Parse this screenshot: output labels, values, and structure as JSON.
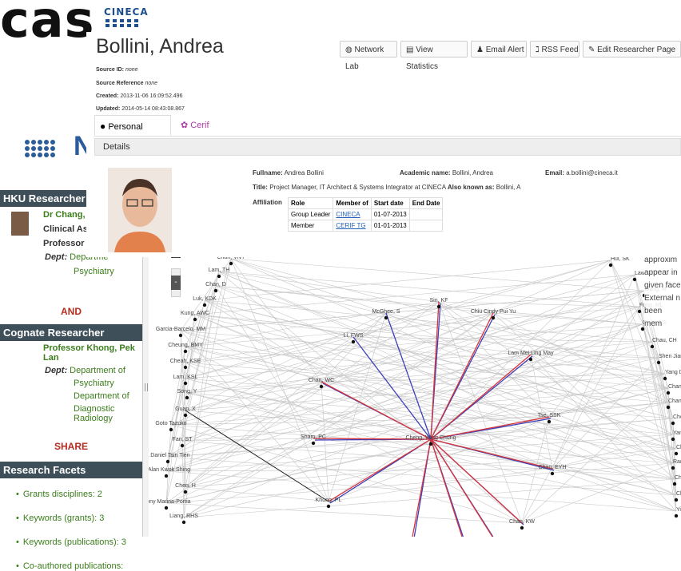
{
  "background": {
    "big_text_top": "cas",
    "big_text_mid": "I",
    "cineca_logo_word": "CINECA",
    "n_letter": "N"
  },
  "profile": {
    "name": "Bollini, Andrea",
    "toolbar": [
      "Network Lab",
      "View Statistics",
      "Email Alert",
      "RSS Feed",
      "Edit Researcher Page"
    ],
    "meta": {
      "source_id_label": "Source ID:",
      "source_id": "none",
      "source_ref_label": "Source Reference",
      "source_ref": "none",
      "created_label": "Created:",
      "created": "2013-11-06 16:09:52.496",
      "updated_label": "Updated:",
      "updated": "2014-05-14 08:43:08.867"
    },
    "tabs": [
      "Personal Page",
      "Cerif"
    ],
    "details_header": "Details",
    "fullname_label": "Fullname:",
    "fullname": "Andrea Bollini",
    "academic_label": "Academic name:",
    "academic": "Bollini, Andrea",
    "email_label": "Email:",
    "email": "a.bollini@cineca.it",
    "title_label": "Title:",
    "title": "Project Manager, IT Architect & Systems Integrator at CINECA",
    "aka_label": "Also known as:",
    "aka": "Bollini, A",
    "affiliation_label": "Affiliation",
    "aff_headers": [
      "Role",
      "Member of",
      "Start date",
      "End Date"
    ],
    "aff_rows": [
      {
        "role": "Group Leader",
        "member": "CINECA",
        "start": "01-07-2013",
        "end": ""
      },
      {
        "role": "Member",
        "member": "CERIF TG",
        "start": "01-01-2013",
        "end": ""
      }
    ]
  },
  "sidebar": {
    "hku_header": "HKU Researcher",
    "hku_name": "Dr Chang, Wing",
    "hku_role1": "Clinical Assista",
    "hku_role2": "Professor",
    "hku_dept_label": "Dept:",
    "hku_dept": "Departme",
    "hku_dept2": "Psychiatry",
    "and": "AND",
    "cognate_header": "Cognate Researcher",
    "cognate_name": "Professor Khong, Pek Lan",
    "cognate_dept_label": "Dept:",
    "cognate_dept1": "Department of",
    "cognate_dept2": "Psychiatry",
    "cognate_dept3": "Department of",
    "cognate_dept4": "Diagnostic Radiology",
    "share": "SHARE",
    "facets_header": "Research Facets",
    "facets": [
      "Grants disciplines: 2",
      "Keywords (grants): 3",
      "Keywords (publications): 3",
      "Co-authored publications:"
    ]
  },
  "graph": {
    "zoom_minus": "-",
    "left_labels": [
      "Chan, VNY",
      "Lam, TH",
      "Chan, D",
      "Luk, KDK",
      "Kung, AWC",
      "Garcia-Barcelo, MM",
      "Cheung, BMY",
      "Cheah, KSE",
      "Lam, KSL",
      "Song, Y",
      "Guan, X",
      "Goto Tazuko",
      "Fan, ST",
      "a Daniel Tsin Tien",
      "ig Alan Kwok Shing",
      "Chen, H",
      "thony Marina-Portia",
      "Liang, RHS"
    ],
    "inner_labels": [
      "McGhee, S",
      "Sin, KF",
      "Chiu Cindy Pui Yu",
      "Li, FWS",
      "Lam Mei Ling May",
      "Chan, WC",
      "Tse, SSK",
      "Sham, PC",
      "Cheng, Wing Chung",
      "Chen, EYH",
      "Khong, PL",
      "Chan, KW"
    ],
    "right_labels": [
      "Hui, SK",
      "Law, ACK",
      "Wang, M",
      "Fung, ML",
      "Chan, YS",
      "Chau, CH",
      "Shen Jiangang",
      "Yang Dan",
      "Chan, BP",
      "Chan, L",
      "Che, C",
      "Yan, EC",
      "Chua, J",
      "Ran, N",
      "Cheung,",
      "Chung, K",
      "Yip, PSF"
    ],
    "overlay_text": [
      "approxim",
      "appear in",
      "given face",
      "External n",
      "been mem"
    ]
  }
}
